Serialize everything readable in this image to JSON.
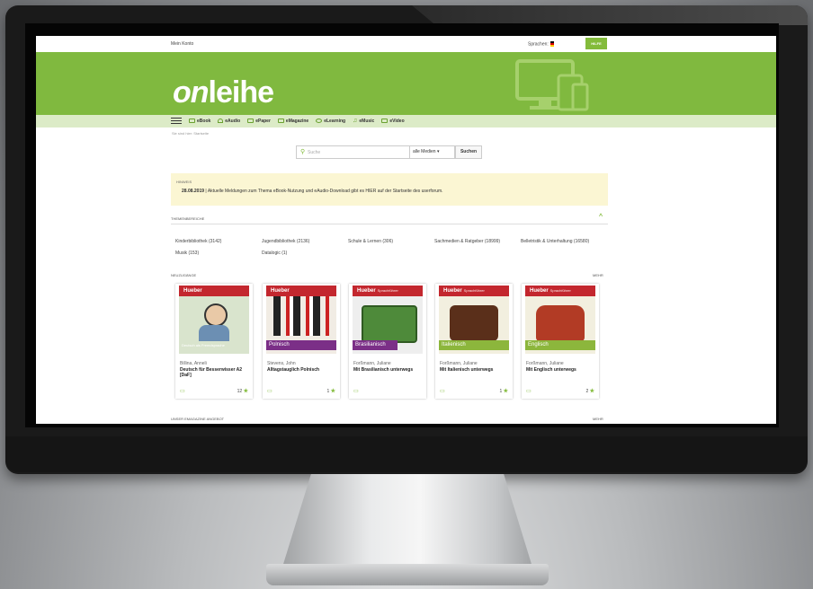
{
  "topbar": {
    "account": "Mein Konto",
    "language": "Sprachen:",
    "help": "HILFE"
  },
  "logo": {
    "on": "on",
    "rest": "leihe"
  },
  "nav": [
    {
      "label": "eBook"
    },
    {
      "label": "eAudio"
    },
    {
      "label": "ePaper"
    },
    {
      "label": "eMagazine"
    },
    {
      "label": "eLearning"
    },
    {
      "label": "eMusic"
    },
    {
      "label": "eVideo"
    }
  ],
  "breadcrumb": "Sie sind hier:   Startseite",
  "search": {
    "placeholder": "Suche",
    "media": "alle Medien",
    "button": "Suchen"
  },
  "notice": {
    "heading": "HINWEIS",
    "date": "28.08.2019",
    "text": "| Aktuelle Meldungen zum Thema eBook-Nutzung und eAudio-Download gibt es HIER auf der Startseite des  userforum."
  },
  "topics_heading": "THEMENBEREICHE",
  "topics": [
    "Kinderbibliothek (3142)",
    "Jugendbibliothek (2136)",
    "Schule & Lernen (306)",
    "Sachmedien & Ratgeber (18999)",
    "Belletristik & Unterhaltung (16580)",
    "Musik (153)",
    "Datalogic (1)"
  ],
  "new_heading": "NEUZUGÄNGE",
  "more": "MEHR",
  "books": [
    {
      "publisher": "Hueber",
      "series": "",
      "tag": "Deutsch als Fremdsprache",
      "tag_color": "#4a7bb7",
      "author": "Billina, Anneli",
      "title": "Deutsch für Besserwisser A2 [DaF]",
      "rating": "12"
    },
    {
      "publisher": "Hueber",
      "series": "",
      "tag": "Polnisch",
      "tag_color": "#7b2f87",
      "author": "Stevens, John",
      "title": "Alltagstauglich Polnisch",
      "rating": "1"
    },
    {
      "publisher": "Hueber",
      "series": "Sprachführer",
      "tag": "Brasilianisch",
      "tag_color": "#7b2f87",
      "author": "Forßmann, Juliane",
      "title": "Mit Brasilianisch unterwegs",
      "rating": ""
    },
    {
      "publisher": "Hueber",
      "series": "Sprachführer",
      "tag": "Italienisch",
      "tag_color": "#8cb63c",
      "author": "Forßmann, Juliane",
      "title": "Mit Italienisch unterwegs",
      "rating": "1"
    },
    {
      "publisher": "Hueber",
      "series": "Sprachführer",
      "tag": "Englisch",
      "tag_color": "#8cb63c",
      "author": "Forßmann, Juliane",
      "title": "Mit Englisch unterwegs",
      "rating": "2"
    }
  ],
  "magazine_heading": "UNSER EMAGAZINE ANGEBOT",
  "colors": {
    "brand": "#80b93f",
    "nav_bg": "#dcebc7",
    "notice_bg": "#fbf6d3",
    "publisher_red": "#c3272e"
  }
}
